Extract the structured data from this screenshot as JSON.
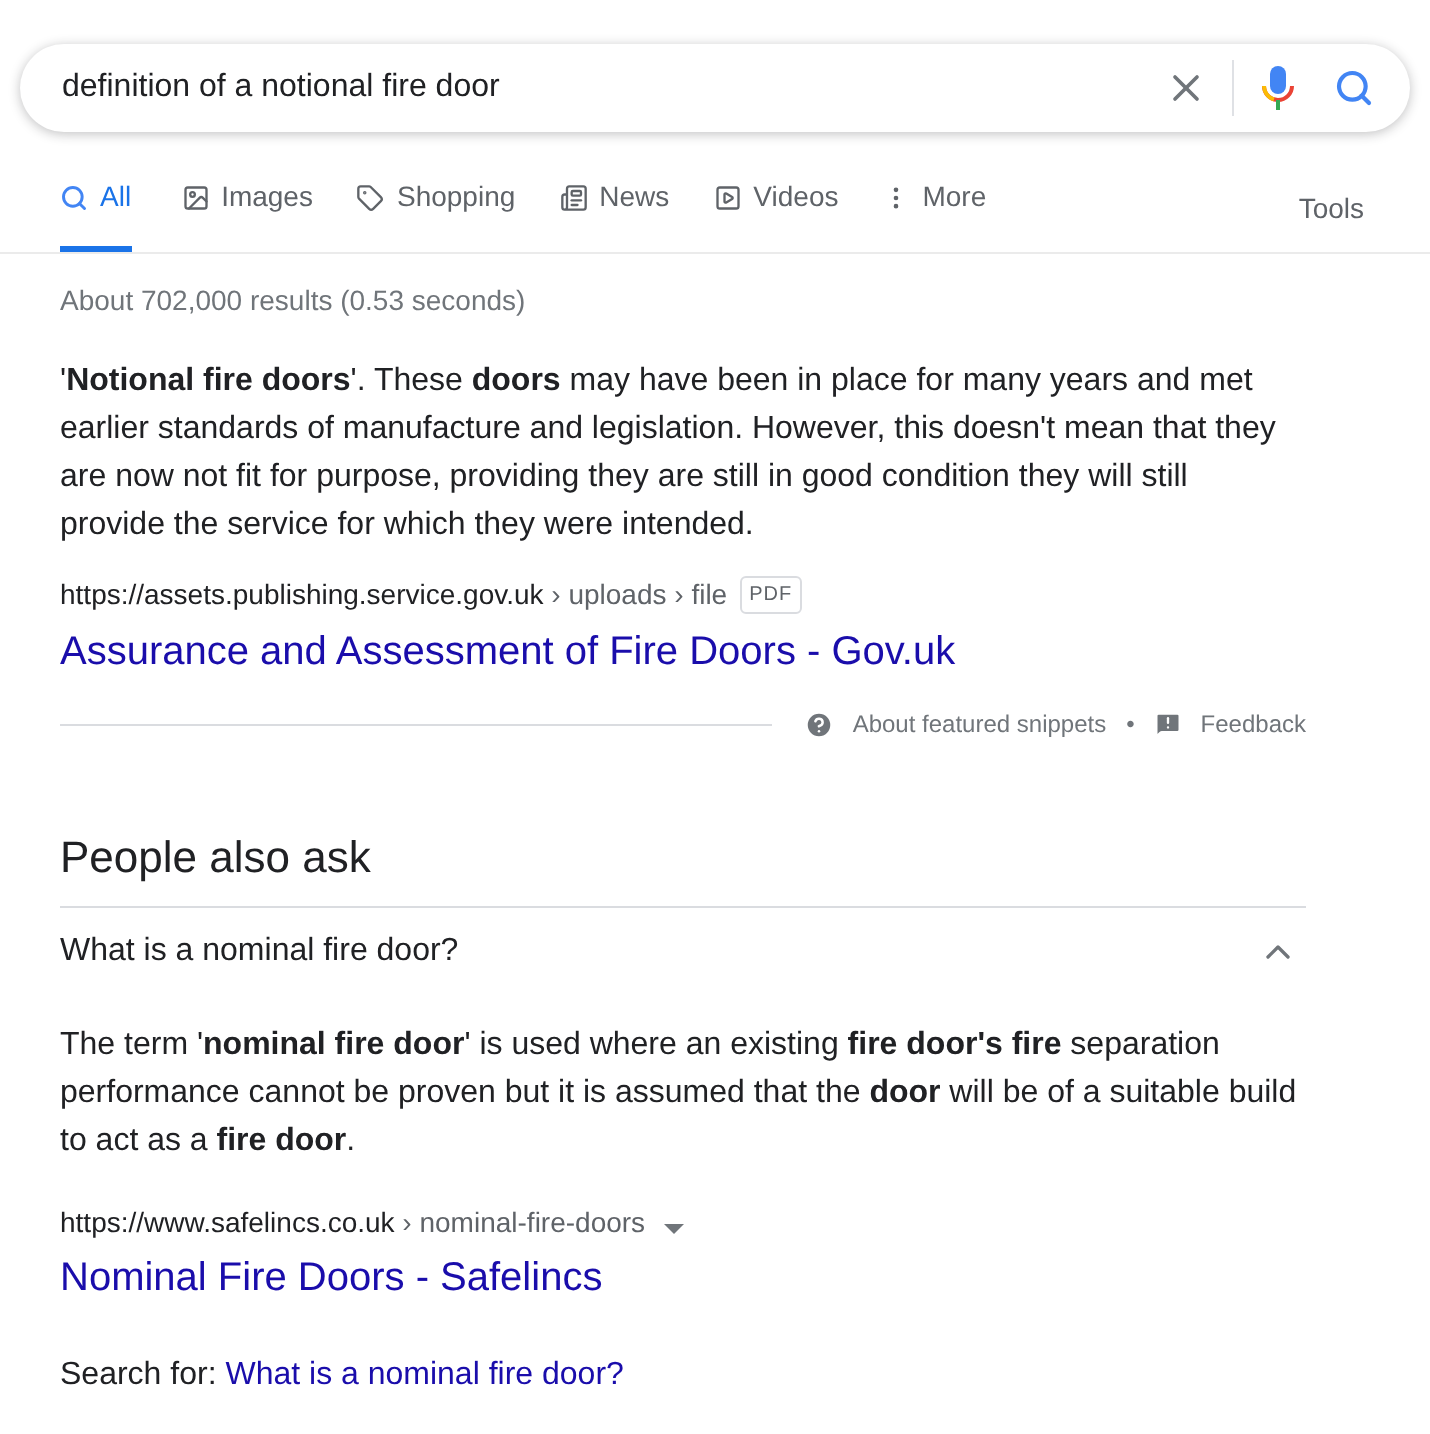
{
  "search": {
    "value": "definition of a notional fire door"
  },
  "tabs": [
    {
      "label": "All",
      "kind": "all",
      "selected": true
    },
    {
      "label": "Images",
      "kind": "images",
      "selected": false
    },
    {
      "label": "Shopping",
      "kind": "shopping",
      "selected": false
    },
    {
      "label": "News",
      "kind": "news",
      "selected": false
    },
    {
      "label": "Videos",
      "kind": "videos",
      "selected": false
    },
    {
      "label": "More",
      "kind": "more",
      "selected": false
    }
  ],
  "tools": "Tools",
  "result_stats": "About 702,000 results (0.53 seconds)",
  "featured_snippet": {
    "text": "'**Notional fire doors**'. These **doors** may have been in place for many years and met earlier standards of manufacture and legislation. However, this doesn't mean that they are now not fit for purpose, providing they are still in good condition they will still provide the service for which they were intended.",
    "domain": "https://assets.publishing.service.gov.uk",
    "path": " › uploads › file",
    "badge": "PDF",
    "title": "Assurance and Assessment of Fire Doors - Gov.uk",
    "about": "About featured snippets",
    "separator": "•",
    "feedback": "Feedback"
  },
  "people_also_ask": {
    "heading": "People also ask",
    "items": [
      {
        "question": "What is a nominal fire door?",
        "expanded": true,
        "answer": "The term '**nominal fire door**' is used where an existing **fire door's fire** separation performance cannot be proven but it is assumed that the **door** will be of a suitable build to act as a **fire door**.",
        "domain": "https://www.safelincs.co.uk",
        "path": " › nominal-fire-doors",
        "title": "Nominal Fire Doors - Safelincs",
        "search_for_label": "Search for:",
        "search_for_link": "What is a nominal fire door?"
      }
    ]
  }
}
